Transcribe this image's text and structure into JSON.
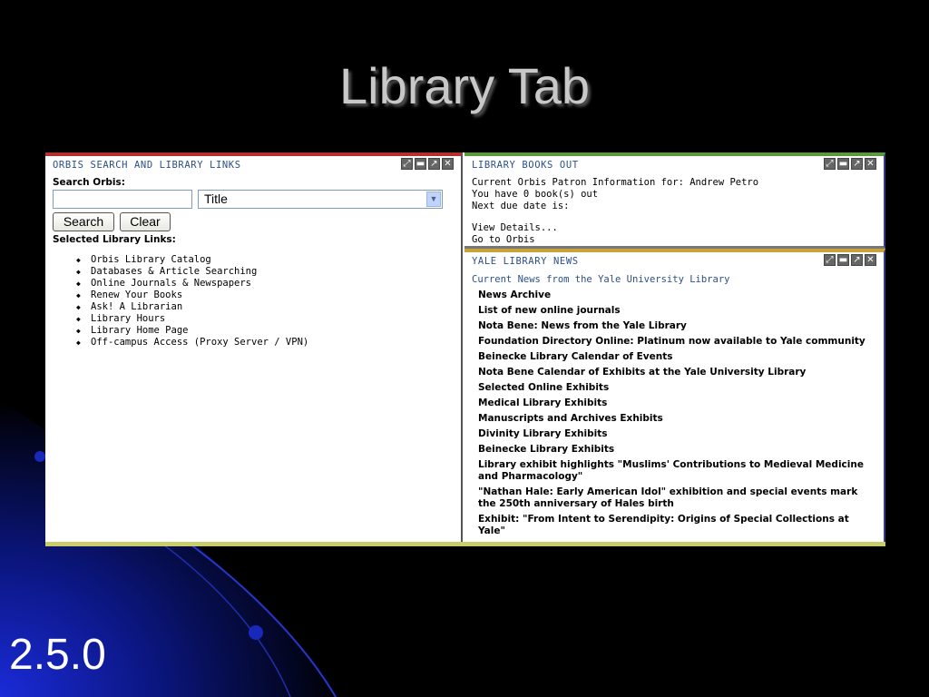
{
  "slide": {
    "title": "Library Tab",
    "version": "2.5.0"
  },
  "controls": {
    "maximize": "⤢",
    "minimize": "▬",
    "popout": "↗",
    "close": "✕"
  },
  "orbis": {
    "header": "ORBIS SEARCH AND LIBRARY LINKS",
    "search_label": "Search Orbis:",
    "search_value": "",
    "select_value": "Title",
    "search_button": "Search",
    "clear_button": "Clear",
    "links_label": "Selected Library Links:",
    "links": [
      "Orbis Library Catalog",
      "Databases & Article Searching",
      "Online Journals & Newspapers",
      "Renew Your Books",
      "Ask! A Librarian",
      "Library Hours",
      "Library Home Page",
      "Off-campus Access (Proxy Server / VPN)"
    ]
  },
  "books": {
    "header": "LIBRARY BOOKS OUT",
    "line1": "Current Orbis Patron Information for: Andrew Petro",
    "line2": "You have 0 book(s) out",
    "line3": "Next due date is:",
    "view_details": "View Details...",
    "go_to_orbis": "Go to Orbis"
  },
  "news": {
    "header": "YALE LIBRARY NEWS",
    "subtitle": "Current News from the Yale University Library",
    "items": [
      "News Archive",
      "List of new online journals",
      "Nota Bene: News from the Yale Library",
      "Foundation Directory Online: Platinum now available to Yale community",
      "Beinecke Library Calendar of Events",
      "Nota Bene Calendar of Exhibits at the Yale University Library",
      "Selected Online Exhibits",
      "Medical Library Exhibits",
      "Manuscripts and Archives Exhibits",
      "Divinity Library Exhibits",
      "Beinecke Library Exhibits",
      "Library exhibit highlights \"Muslims' Contributions to Medieval Medicine and Pharmacology\"",
      "\"Nathan Hale: Early American Idol\" exhibition and special events mark the 250th anniversary of Hales birth",
      "Exhibit: \"From Intent to Serendipity: Origins of Special Collections at Yale\""
    ]
  },
  "colors": {
    "background": "#000000",
    "orbis_accent": "#b5302c",
    "books_accent": "#5a9a3a",
    "news_accent": "#c9a23a",
    "footer_bar": "#c9cc6a",
    "header_text": "#2a4f8a"
  }
}
